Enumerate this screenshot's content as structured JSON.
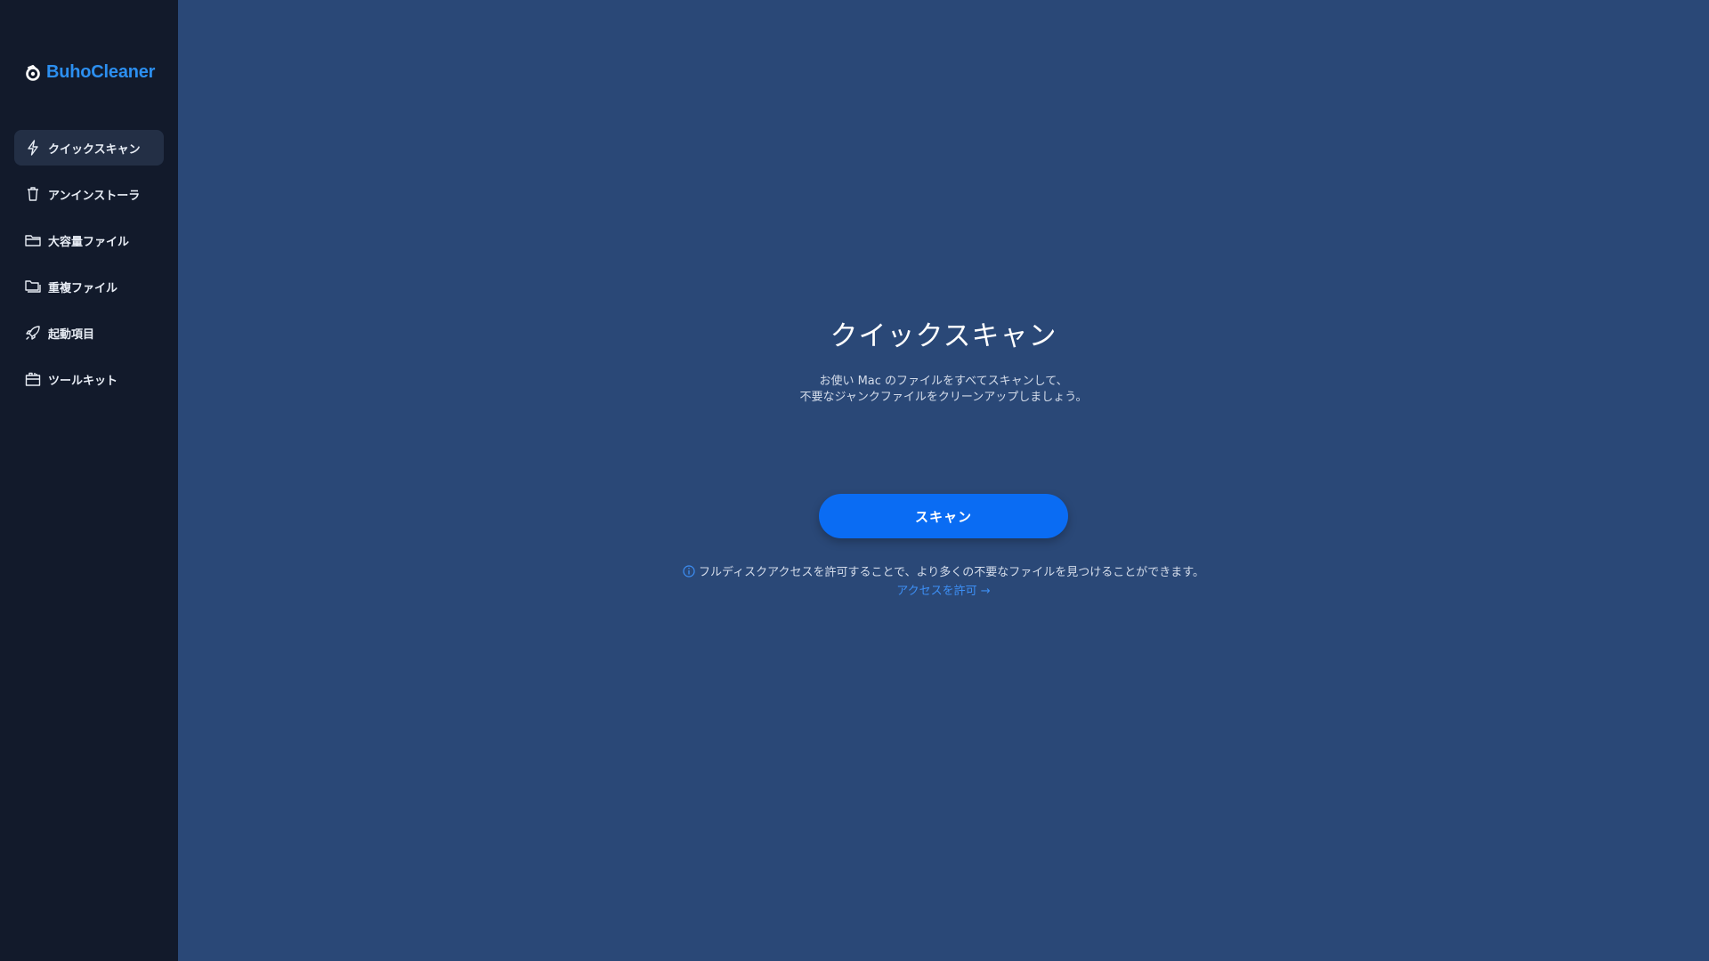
{
  "app": {
    "name": "BuhoCleaner",
    "brand_color": "#2c8ff0"
  },
  "sidebar": {
    "items": [
      {
        "label": "クイックスキャン",
        "icon": "lightning-icon",
        "active": true
      },
      {
        "label": "アンインストーラ",
        "icon": "trash-icon",
        "active": false
      },
      {
        "label": "大容量ファイル",
        "icon": "folder-icon",
        "active": false
      },
      {
        "label": "重複ファイル",
        "icon": "duplicate-folder-icon",
        "active": false
      },
      {
        "label": "起動項目",
        "icon": "rocket-icon",
        "active": false
      },
      {
        "label": "ツールキット",
        "icon": "toolkit-icon",
        "active": false
      }
    ]
  },
  "main": {
    "title": "クイックスキャン",
    "description_line1": "お使い Mac のファイルをすべてスキャンして、",
    "description_line2": "不要なジャンクファイルをクリーンアップしましょう。",
    "scan_button": "スキャン",
    "info_text": "フルディスクアクセスを許可することで、より多くの不要なファイルを見つけることができます。",
    "access_link": "アクセスを許可 →",
    "accent_color": "#0a6cf3"
  }
}
